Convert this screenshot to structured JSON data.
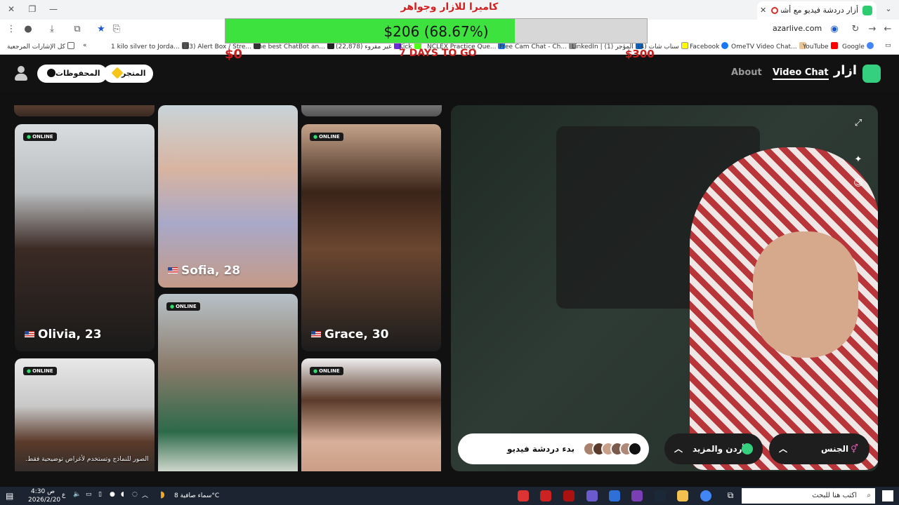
{
  "browser": {
    "tab_title": "أزار دردشة فيديو مع أشخاص",
    "url": "azarlive.com",
    "bookmarks": [
      "كل الإشارات المرجعية",
      "1 kilo silver to Jorda...",
      "(33) Alert Box / Stre...",
      "The best ChatBot an...",
      "(22,878) غير مقروء",
      "Kick",
      "NCLEX Practice Que...",
      "Free Cam Chat - Ch...",
      "LinkedIn | (1) المؤجر",
      "(4) سناب شات",
      "Facebook",
      "OmeTV Video Chat...",
      "YouTube",
      "Google"
    ]
  },
  "overlay": {
    "title": "كاميرا للازار وجواهر",
    "goal_text": "$206 (68.67%)",
    "goal_fraction": 0.6867,
    "start_amount": "$0",
    "days_left": "7 DAYS TO GO",
    "target_amount": "$300"
  },
  "header": {
    "logo_text": "ازار",
    "nav_video_chat": "Video Chat",
    "nav_about": "About",
    "store_label": "المتجر",
    "saved_label": "المحفوظات"
  },
  "profiles": {
    "online_badge": "ONLINE",
    "sofia": "Sofia, 28",
    "olivia": "Olivia, 23",
    "grace": "Grace, 30",
    "disclaimer": "الصور للنماذج وتستخدم لأغراض توضيحية فقط."
  },
  "video_controls": {
    "start_label": "بدء دردشة فيديو",
    "country_label": "الأردن والمزيد",
    "gender_label": "الجنس"
  },
  "taskbar": {
    "search_placeholder": "اكتب هنا للبحث",
    "weather": "سماء صافية  8°C",
    "time": "4:30 ص",
    "date": "2026/2/20",
    "lang": "ع"
  },
  "colors": {
    "goal_fill": "#3ee23e",
    "overlay_red": "#d21f1f",
    "brand_green": "#35d07f"
  }
}
